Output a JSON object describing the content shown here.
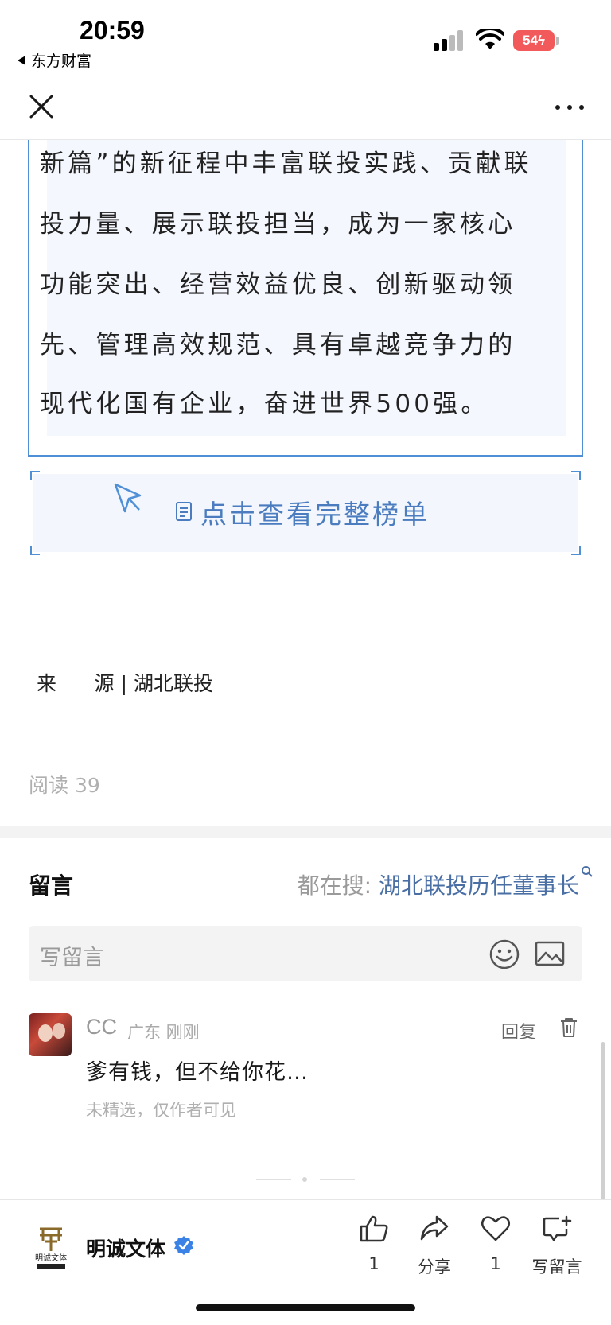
{
  "status_bar": {
    "time": "20:59",
    "back_app": "东方财富",
    "battery": "54"
  },
  "article": {
    "quote_lines": [
      "新篇”的新征程中丰富联投实践、贡献联",
      "投力量、展示联投担当，成为一家核心",
      "功能突出、经营效益优良、创新驱动领",
      "先、管理高效规范、具有卓越竞争力的",
      "现代化国有企业，奋进世界500强。"
    ],
    "full_list_button": "点击查看完整榜单",
    "source": "来      源 | 湖北联投",
    "reads": "阅读 39"
  },
  "comments": {
    "title": "留言",
    "search_prefix": "都在搜:",
    "search_query": "湖北联投历任董事长",
    "input_placeholder": "写留言",
    "items": [
      {
        "user": "CC",
        "meta": "广东 刚刚",
        "reply": "回复",
        "text": "爹有钱，但不给你花…",
        "note": "未精选，仅作者可见"
      }
    ]
  },
  "bottom_bar": {
    "account_name": "明诚文体",
    "logo_text": "明诚文体",
    "like_count": "1",
    "share_label": "分享",
    "heart_count": "1",
    "comment_label": "写留言"
  },
  "colors": {
    "accent_blue": "#4f8fd6",
    "link_blue": "#4a6fa5",
    "battery_red": "#f2595b"
  },
  "icons": [
    "close-icon",
    "more-icon",
    "cursor-icon",
    "document-icon",
    "search-icon",
    "emoji-icon",
    "image-icon",
    "trash-icon",
    "verified-icon",
    "thumbs-up-icon",
    "share-icon",
    "heart-icon",
    "comment-icon"
  ]
}
